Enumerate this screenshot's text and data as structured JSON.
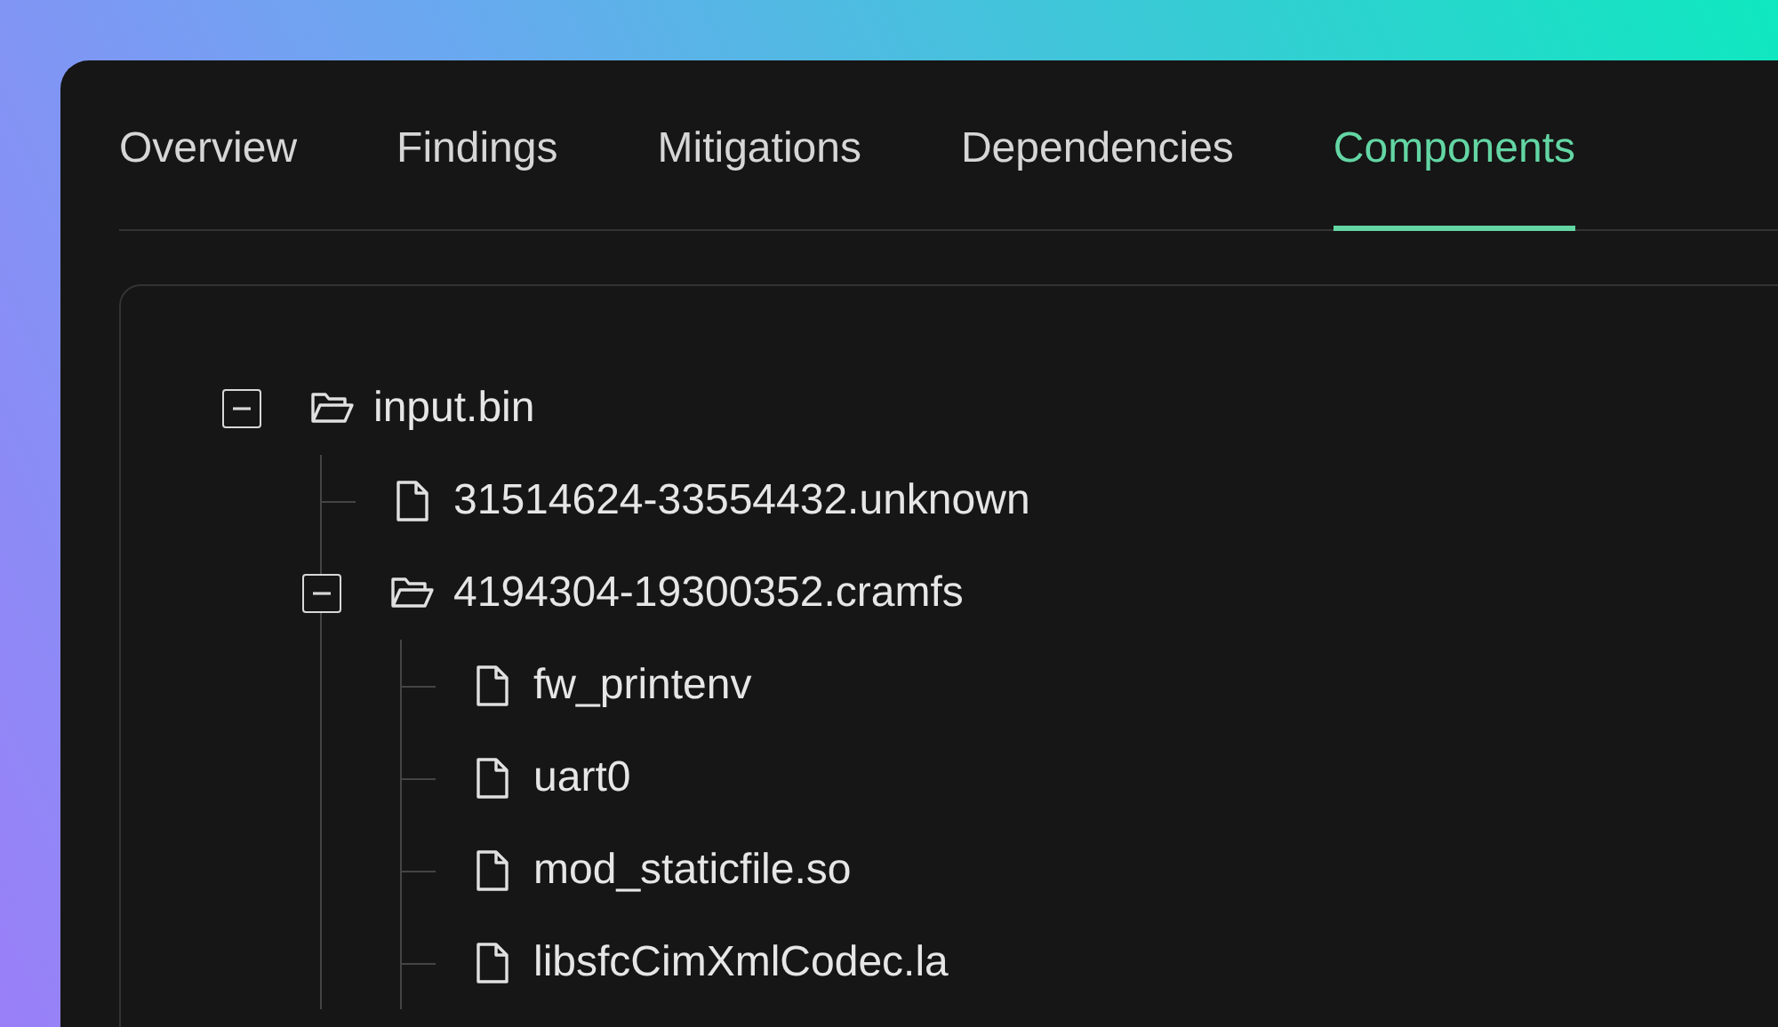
{
  "tabs": [
    {
      "label": "Overview",
      "selected": false
    },
    {
      "label": "Findings",
      "selected": false
    },
    {
      "label": "Mitigations",
      "selected": false
    },
    {
      "label": "Dependencies",
      "selected": false
    },
    {
      "label": "Components",
      "selected": true
    }
  ],
  "tree": [
    {
      "name": "input.bin",
      "kind": "folder",
      "expanded": true,
      "children": [
        {
          "name": "31514624-33554432.unknown",
          "kind": "file"
        },
        {
          "name": "4194304-19300352.cramfs",
          "kind": "folder",
          "expanded": true,
          "children": [
            {
              "name": "fw_printenv",
              "kind": "file"
            },
            {
              "name": "uart0",
              "kind": "file"
            },
            {
              "name": "mod_staticfile.so",
              "kind": "file"
            },
            {
              "name": "libsfcCimXmlCodec.la",
              "kind": "file"
            }
          ]
        }
      ]
    }
  ]
}
